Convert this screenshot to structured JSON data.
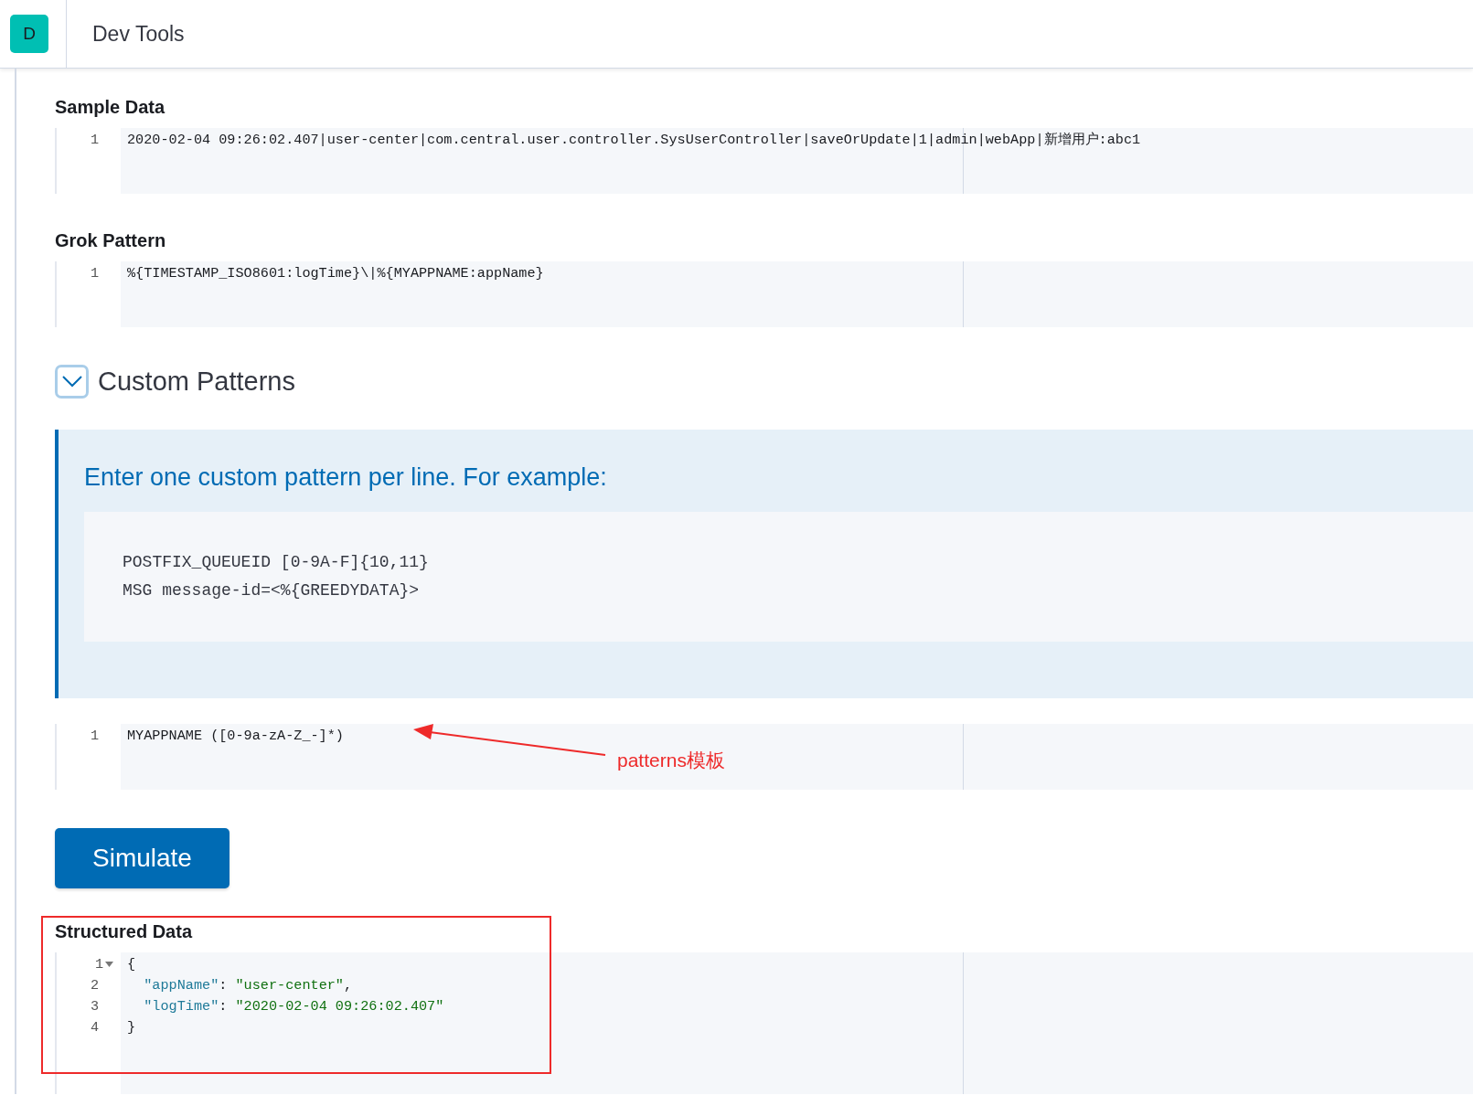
{
  "app": {
    "logo_letter": "D",
    "title": "Dev Tools"
  },
  "sample_data": {
    "label": "Sample Data",
    "lines": [
      {
        "number": "1",
        "text": "2020-02-04 09:26:02.407|user-center|com.central.user.controller.SysUserController|saveOrUpdate|1|admin|webApp|新增用户:abc1"
      }
    ]
  },
  "grok_pattern": {
    "label": "Grok Pattern",
    "lines": [
      {
        "number": "1",
        "text": "%{TIMESTAMP_ISO8601:logTime}\\|%{MYAPPNAME:appName}"
      }
    ]
  },
  "custom_patterns": {
    "title": "Custom Patterns",
    "expanded": true,
    "callout": {
      "title": "Enter one custom pattern per line. For example:",
      "example_lines": [
        "POSTFIX_QUEUEID [0-9A-F]{10,11}",
        "MSG message-id=<%{GREEDYDATA}>"
      ]
    },
    "lines": [
      {
        "number": "1",
        "text": "MYAPPNAME ([0-9a-zA-Z_-]*)"
      }
    ]
  },
  "simulate_button": "Simulate",
  "structured_data": {
    "label": "Structured Data",
    "lines": [
      {
        "number": "1",
        "foldable": true,
        "tokens": [
          {
            "kind": "punct",
            "text": "{"
          }
        ]
      },
      {
        "number": "2",
        "foldable": false,
        "tokens": [
          {
            "kind": "key",
            "text": "  \"appName\""
          },
          {
            "kind": "punct",
            "text": ": "
          },
          {
            "kind": "string",
            "text": "\"user-center\""
          },
          {
            "kind": "punct",
            "text": ","
          }
        ]
      },
      {
        "number": "3",
        "foldable": false,
        "tokens": [
          {
            "kind": "key",
            "text": "  \"logTime\""
          },
          {
            "kind": "punct",
            "text": ": "
          },
          {
            "kind": "string",
            "text": "\"2020-02-04 09:26:02.407\""
          }
        ]
      },
      {
        "number": "4",
        "foldable": false,
        "tokens": [
          {
            "kind": "punct",
            "text": "}"
          }
        ]
      }
    ]
  },
  "annotations": [
    {
      "kind": "arrow",
      "text": "patterns模板"
    },
    {
      "kind": "box"
    }
  ]
}
